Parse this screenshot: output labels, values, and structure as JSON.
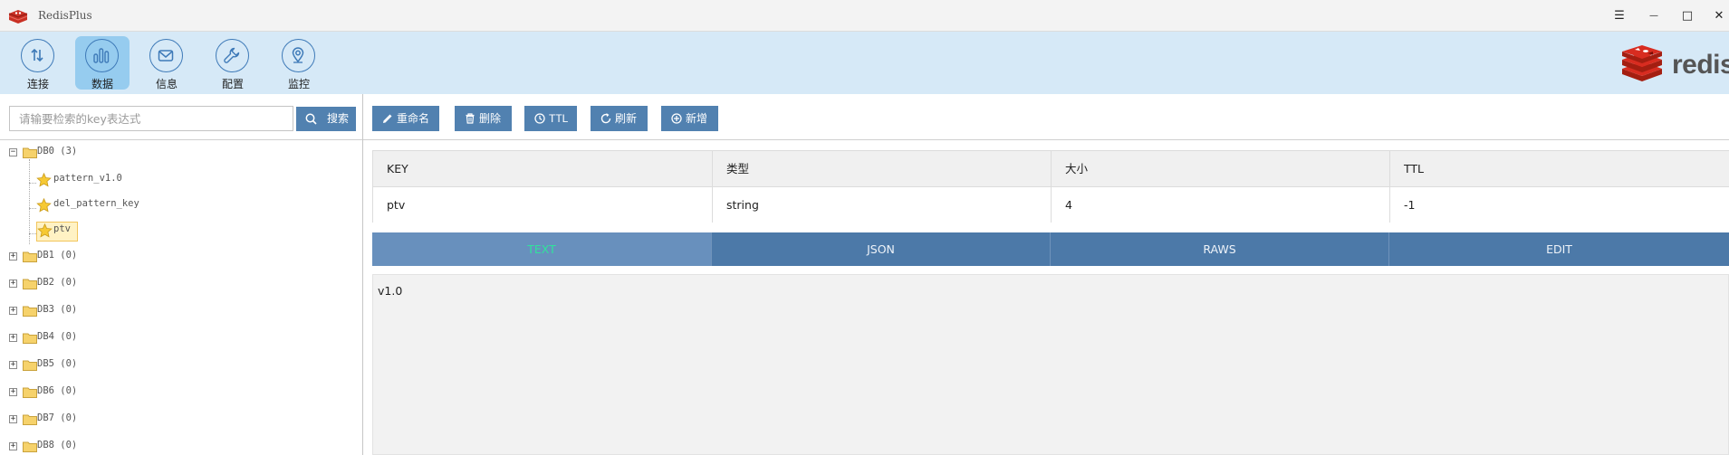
{
  "window": {
    "title": "RedisPlus",
    "controls": {
      "menu": "☰",
      "minimize": "—",
      "maximize": "□",
      "close": "✕"
    }
  },
  "topnav": {
    "items": [
      {
        "label": "连接",
        "icon": "connect-arrows-icon",
        "active": false
      },
      {
        "label": "数据",
        "icon": "bar-chart-icon",
        "active": true
      },
      {
        "label": "信息",
        "icon": "mail-icon",
        "active": false
      },
      {
        "label": "配置",
        "icon": "wrench-icon",
        "active": false
      },
      {
        "label": "监控",
        "icon": "monitor-pin-icon",
        "active": false
      }
    ],
    "logo_text": "redis"
  },
  "search": {
    "placeholder": "请输要检索的key表达式",
    "button_label": "搜索"
  },
  "tree": {
    "db0_label": "DB0 (3)",
    "db0_keys": [
      "pattern_v1.0",
      "del_pattern_key",
      "ptv"
    ],
    "dbs": [
      "DB1 (0)",
      "DB2 (0)",
      "DB3 (0)",
      "DB4 (0)",
      "DB5 (0)",
      "DB6 (0)",
      "DB7 (0)",
      "DB8 (0)"
    ],
    "selected_key": "ptv"
  },
  "actions": {
    "rename": "重命名",
    "delete": "删除",
    "ttl": "TTL",
    "refresh": "刷新",
    "add": "新增"
  },
  "key_table": {
    "headers": [
      "KEY",
      "类型",
      "大小",
      "TTL"
    ],
    "row": [
      "ptv",
      "string",
      "4",
      "-1"
    ]
  },
  "view_tabs": {
    "items": [
      "TEXT",
      "JSON",
      "RAWS",
      "EDIT"
    ],
    "active": "TEXT"
  },
  "value_content": "v1.0",
  "colors": {
    "nav_bg": "#d6e9f7",
    "nav_active": "#96ccef",
    "button": "#5181b0",
    "tab_bg": "#4c79a8",
    "tab_active": "#6890bd",
    "tab_active_text": "#30e39c"
  }
}
